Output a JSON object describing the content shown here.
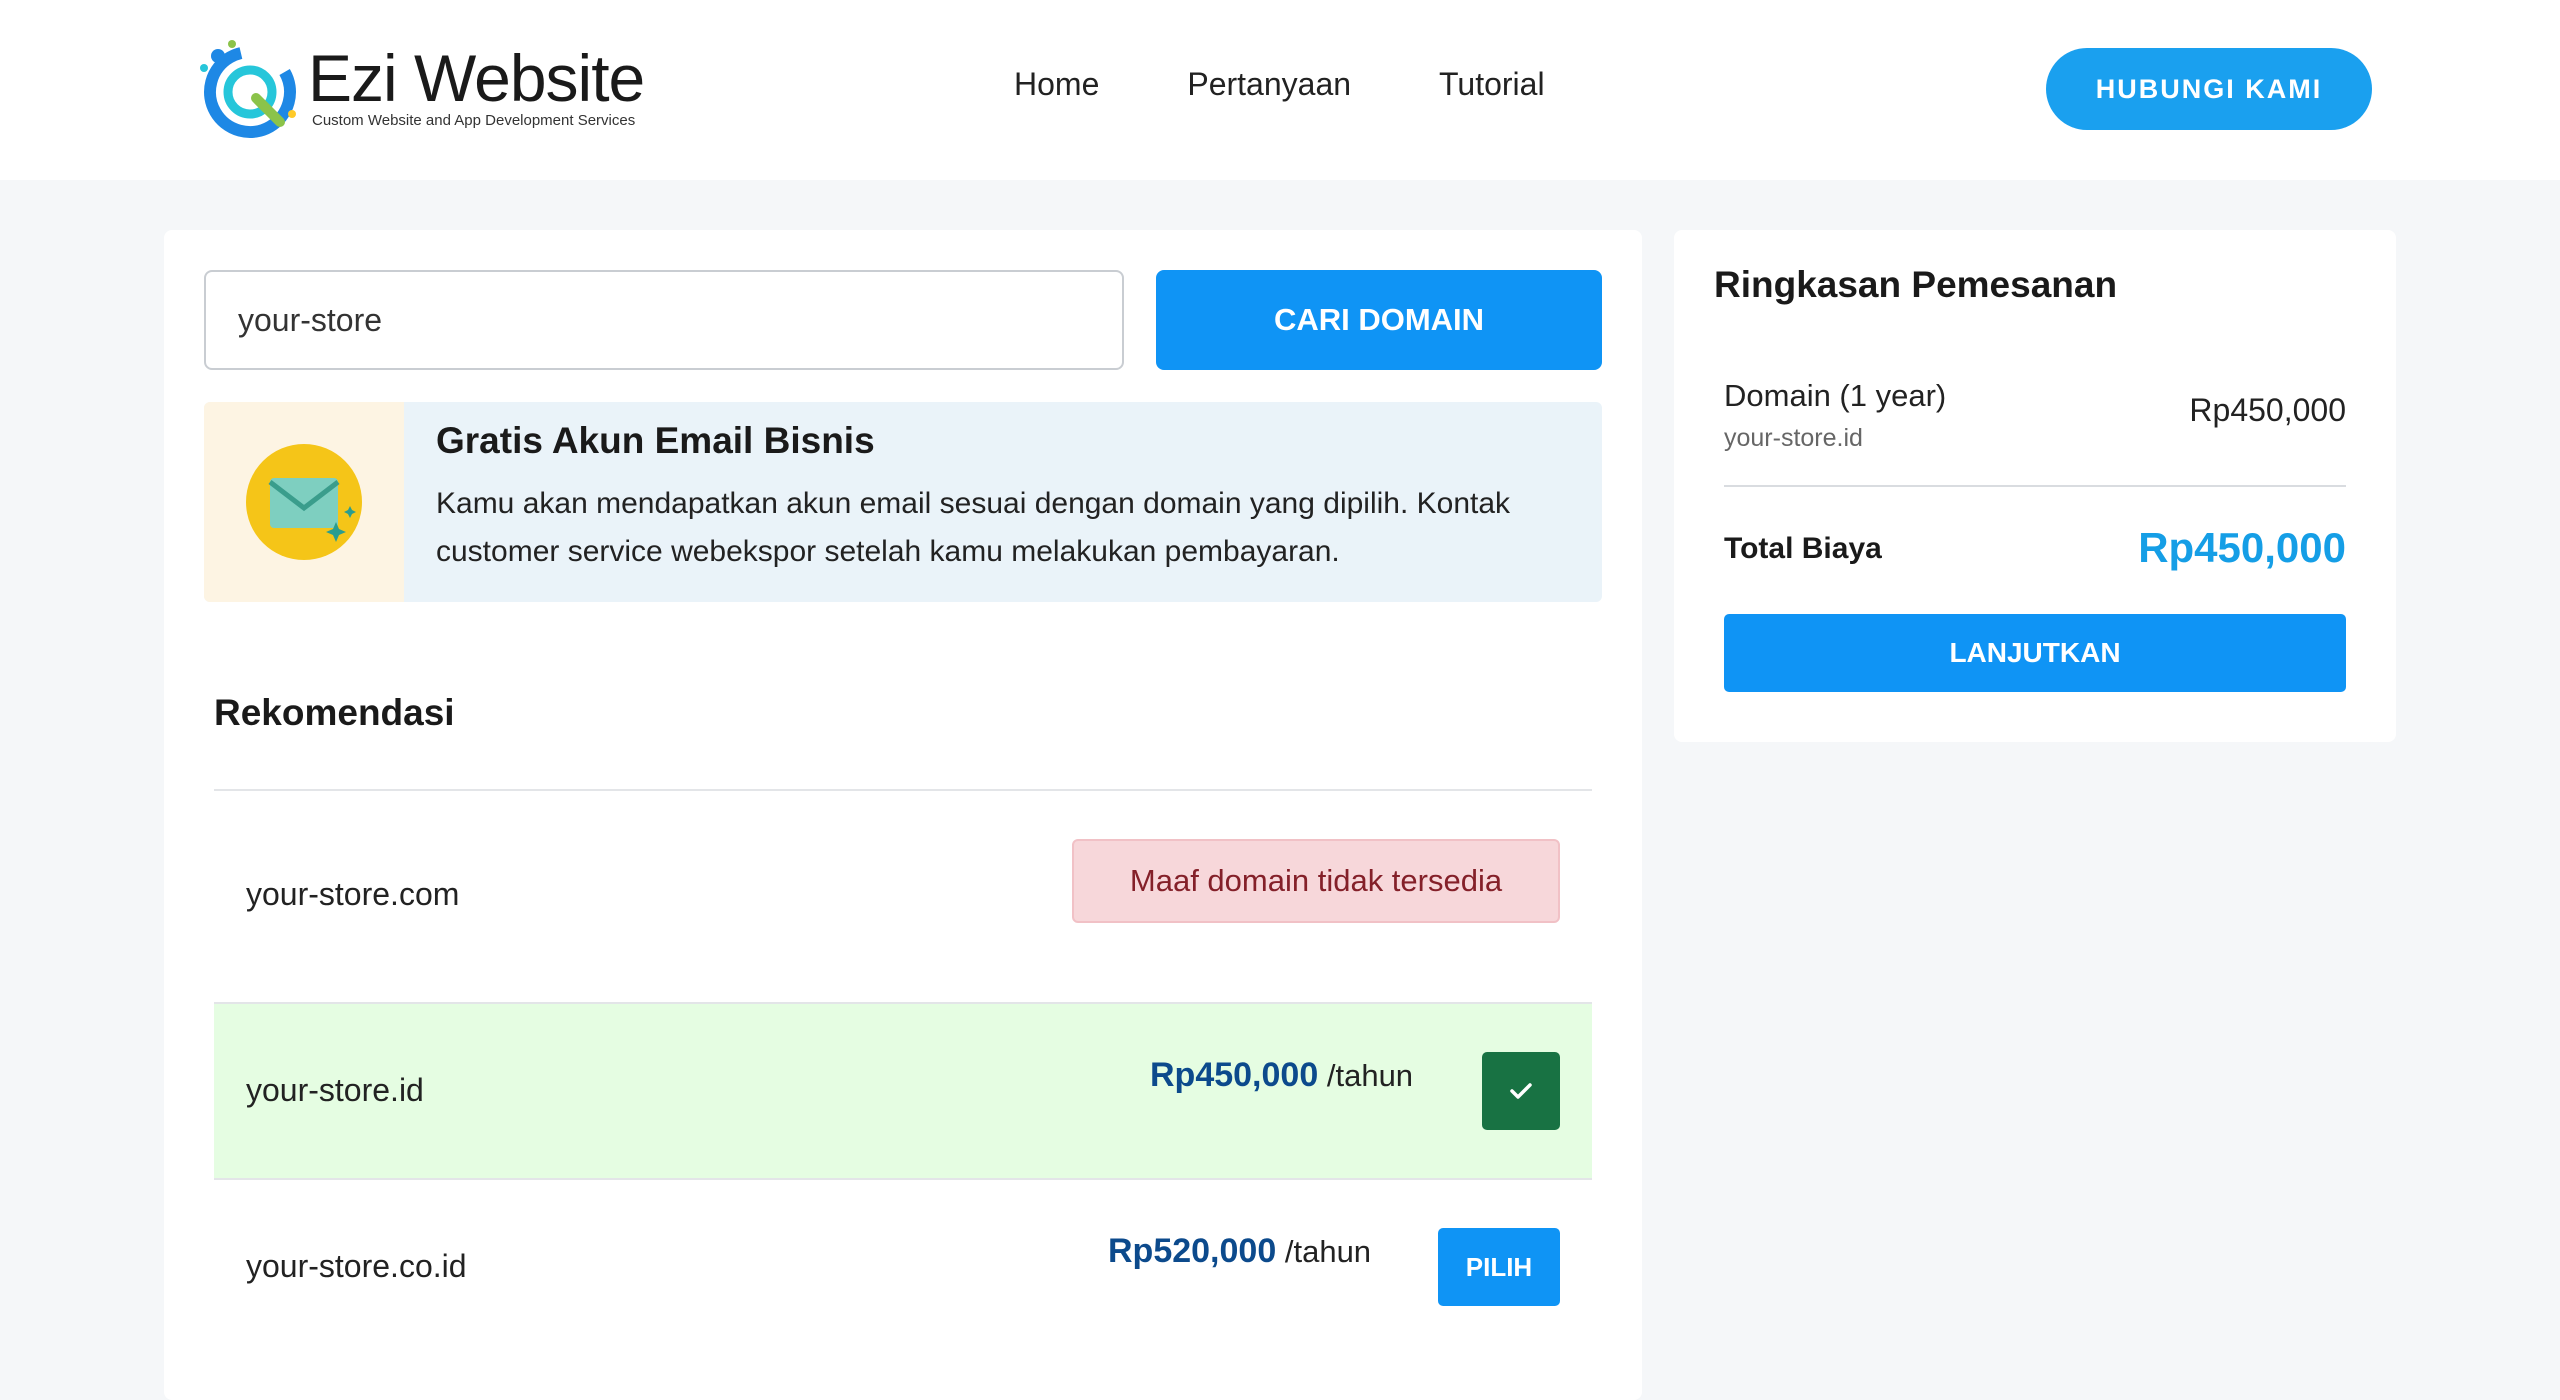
{
  "brand": {
    "name": "Ezi Website",
    "tagline": "Custom Website and App Development Services"
  },
  "nav": {
    "items": [
      {
        "label": "Home"
      },
      {
        "label": "Pertanyaan"
      },
      {
        "label": "Tutorial"
      }
    ],
    "contact_label": "HUBUNGI KAMI"
  },
  "search": {
    "value": "your-store",
    "button_label": "CARI DOMAIN"
  },
  "promo": {
    "title": "Gratis Akun Email Bisnis",
    "text": "Kamu akan mendapatkan akun email sesuai dengan domain yang dipilih. Kontak customer service webekspor setelah kamu melakukan pembayaran.",
    "icon": "envelope-icon"
  },
  "recommendations": {
    "title": "Rekomendasi",
    "rows": [
      {
        "domain": "your-store.com",
        "status": "Maaf domain tidak tersedia"
      },
      {
        "domain": "your-store.id",
        "price": "Rp450,000",
        "period": "/tahun",
        "selected": true
      },
      {
        "domain": "your-store.co.id",
        "price": "Rp520,000",
        "period": "/tahun",
        "button_label": "PILIH"
      }
    ]
  },
  "summary": {
    "title": "Ringkasan Pemesanan",
    "item_label": "Domain (1 year)",
    "item_domain": "your-store.id",
    "item_price": "Rp450,000",
    "total_label": "Total Biaya",
    "total_value": "Rp450,000",
    "button_label": "LANJUTKAN"
  },
  "colors": {
    "primary": "#0f94f5",
    "selected_row": "#e5fde2",
    "unavailable_bg": "#f7d7da",
    "check_button": "#187243",
    "total": "#159ee6"
  }
}
